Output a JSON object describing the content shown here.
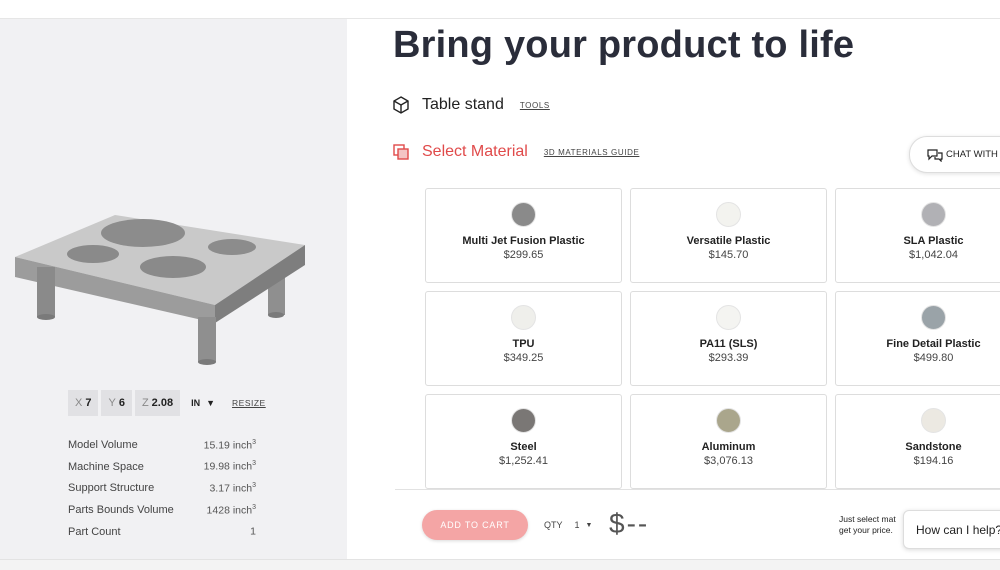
{
  "page": {
    "title": "Bring your product to life"
  },
  "product": {
    "icon": "box-icon",
    "name": "Table stand",
    "tools_link": "TOOLS"
  },
  "material_section": {
    "icon": "material-icon",
    "label": "Select Material",
    "guide_link": "3D MATERIALS GUIDE"
  },
  "chat_button": {
    "icon": "chat-icon",
    "label": "CHAT WITH"
  },
  "materials": [
    {
      "name": "Multi Jet Fusion Plastic",
      "price": "$299.65",
      "color": "#8a8a8a"
    },
    {
      "name": "Versatile Plastic",
      "price": "$145.70",
      "color": "#f3f3ef"
    },
    {
      "name": "SLA Plastic",
      "price": "$1,042.04",
      "color": "#b1b1b5"
    },
    {
      "name": "TPU",
      "price": "$349.25",
      "color": "#efefeb"
    },
    {
      "name": "PA11 (SLS)",
      "price": "$293.39",
      "color": "#f4f4f1"
    },
    {
      "name": "Fine Detail Plastic",
      "price": "$499.80",
      "color": "#9aa3a8"
    },
    {
      "name": "Steel",
      "price": "$1,252.41",
      "color": "#7a7775"
    },
    {
      "name": "Aluminum",
      "price": "$3,076.13",
      "color": "#aaa68c"
    },
    {
      "name": "Sandstone",
      "price": "$194.16",
      "color": "#ece9e2"
    }
  ],
  "dimensions": {
    "x_label": "X",
    "x_value": "7",
    "y_label": "Y",
    "y_value": "6",
    "z_label": "Z",
    "z_value": "2.08",
    "unit": "IN",
    "resize_link": "RESIZE"
  },
  "specs": [
    {
      "label": "Model Volume",
      "value": "15.19 inch",
      "sup": "3"
    },
    {
      "label": "Machine Space",
      "value": "19.98 inch",
      "sup": "3"
    },
    {
      "label": "Support Structure",
      "value": "3.17 inch",
      "sup": "3"
    },
    {
      "label": "Parts Bounds Volume",
      "value": "1428 inch",
      "sup": "3"
    },
    {
      "label": "Part Count",
      "value": "1",
      "sup": ""
    }
  ],
  "footer": {
    "add_to_cart": "ADD TO CART",
    "qty_label": "QTY",
    "qty_value": "1",
    "price": "$--",
    "hint_line1": "Just select mat",
    "hint_line2": "get your price."
  },
  "help_widget": {
    "text": "How can I help?"
  }
}
